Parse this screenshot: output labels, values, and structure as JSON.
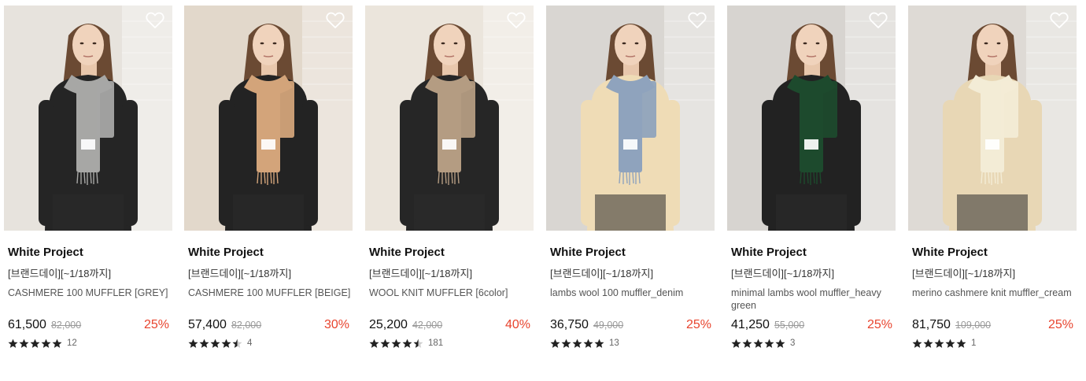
{
  "products": [
    {
      "brand": "White Project",
      "promo": "[브랜드데이][~1/18까지]",
      "name": "CASHMERE 100 MUFFLER [GREY]",
      "price": "61,500",
      "original_price": "82,000",
      "discount": "25%",
      "rating": 5,
      "review_count": "12",
      "scarf_color": "#a7a7a5",
      "top_color": "#252525",
      "bg_color": "#e7e3dd",
      "wishlist_icon": "heart-outline"
    },
    {
      "brand": "White Project",
      "promo": "[브랜드데이][~1/18까지]",
      "name": "CASHMERE 100 MUFFLER [BEIGE]",
      "price": "57,400",
      "original_price": "82,000",
      "discount": "30%",
      "rating": 4.5,
      "review_count": "4",
      "scarf_color": "#d3a47a",
      "top_color": "#232323",
      "bg_color": "#e2d8cb",
      "wishlist_icon": "heart-outline"
    },
    {
      "brand": "White Project",
      "promo": "[브랜드데이][~1/18까지]",
      "name": "WOOL KNIT MUFFLER [6color]",
      "price": "25,200",
      "original_price": "42,000",
      "discount": "40%",
      "rating": 4.5,
      "review_count": "181",
      "scarf_color": "#b49c82",
      "top_color": "#262626",
      "bg_color": "#ebe5dc",
      "wishlist_icon": "heart-outline"
    },
    {
      "brand": "White Project",
      "promo": "[브랜드데이][~1/18까지]",
      "name": "lambs wool 100 muffler_denim",
      "price": "36,750",
      "original_price": "49,000",
      "discount": "25%",
      "rating": 5,
      "review_count": "13",
      "scarf_color": "#8fa3bd",
      "top_color": "#efdcb6",
      "bg_color": "#d9d6d2",
      "wishlist_icon": "heart-outline"
    },
    {
      "brand": "White Project",
      "promo": "[브랜드데이][~1/18까지]",
      "name": "minimal lambs wool muffler_heavy green",
      "price": "41,250",
      "original_price": "55,000",
      "discount": "25%",
      "rating": 5,
      "review_count": "3",
      "scarf_color": "#1d4a2d",
      "top_color": "#222222",
      "bg_color": "#d7d4d0",
      "wishlist_icon": "heart-outline"
    },
    {
      "brand": "White Project",
      "promo": "[브랜드데이][~1/18까지]",
      "name": "merino cashmere knit muffler_cream",
      "price": "81,750",
      "original_price": "109,000",
      "discount": "25%",
      "rating": 5,
      "review_count": "1",
      "scarf_color": "#f3ecd6",
      "top_color": "#e8d7b5",
      "bg_color": "#dedad5",
      "wishlist_icon": "heart-outline"
    }
  ]
}
